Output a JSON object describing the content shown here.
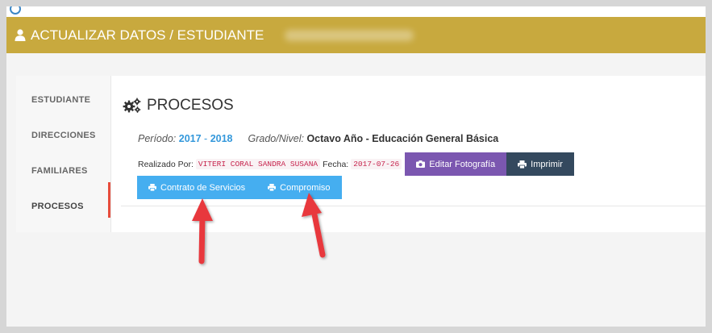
{
  "header": {
    "title": "ACTUALIZAR DATOS / ESTUDIANTE"
  },
  "sidebar": {
    "items": [
      {
        "label": "ESTUDIANTE"
      },
      {
        "label": "DIRECCIONES"
      },
      {
        "label": "FAMILIARES"
      },
      {
        "label": "PROCESOS",
        "active": true
      }
    ]
  },
  "procesos": {
    "title": "PROCESOS",
    "periodo_label": "Período:",
    "year_start": "2017",
    "year_sep": "-",
    "year_end": "2018",
    "grado_label": "Grado/Nivel:",
    "grado_value": "Octavo Año - Educación General Básica",
    "realizado_label": "Realizado Por:",
    "realizado_value": "VITERI CORAL SANDRA SUSANA",
    "fecha_label": "Fecha:",
    "fecha_value": "2017-07-26"
  },
  "buttons": {
    "editar_foto": "Editar Fotografía",
    "imprimir": "Imprimir",
    "contrato": "Contrato de Servicios",
    "compromiso": "Compromiso"
  },
  "colors": {
    "header": "#c8a93e",
    "purple": "#7b57b0",
    "dark": "#34495e",
    "blue": "#45aef0",
    "arrow": "#e8383d"
  }
}
